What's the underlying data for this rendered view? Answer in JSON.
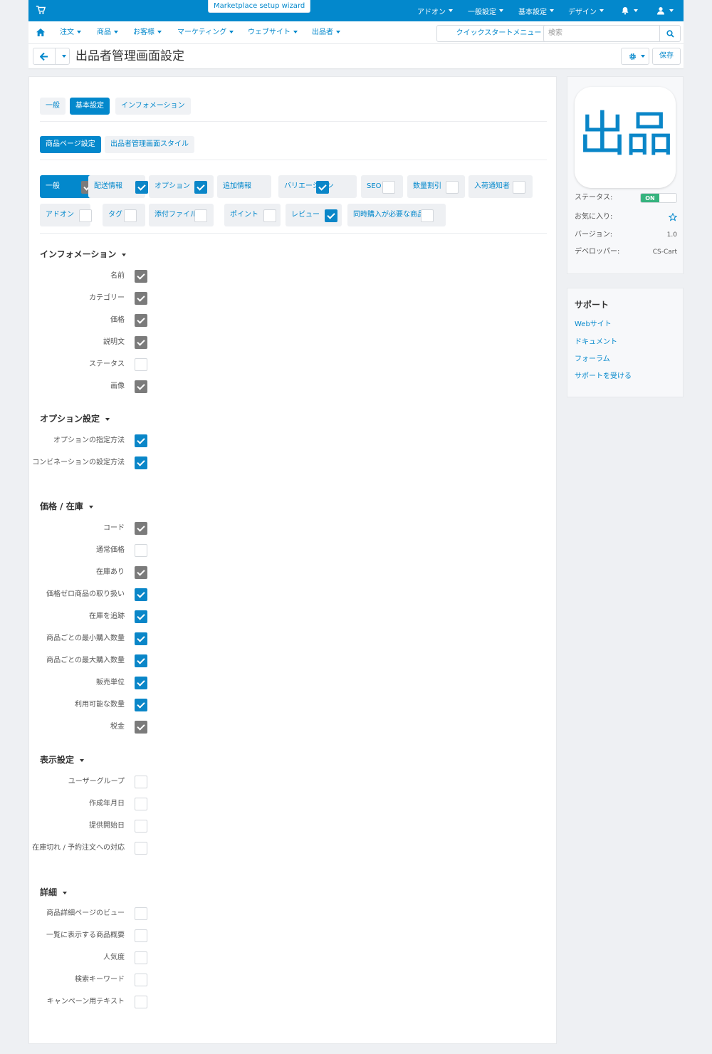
{
  "topbar": {
    "wizard_label": "Marketplace setup wizard",
    "menu": [
      "アドオン",
      "一般設定",
      "基本設定",
      "デザイン"
    ]
  },
  "navbar": {
    "items": [
      "注文",
      "商品",
      "お客様",
      "マーケティング",
      "ウェブサイト",
      "出品者"
    ],
    "quickstart_label": "クイックスタートメニュー",
    "search_placeholder": "検索"
  },
  "header": {
    "title": "出品者管理画面設定",
    "save_label": "保存"
  },
  "tabs": [
    "一般",
    "基本設定",
    "インフォメーション"
  ],
  "active_tab": "基本設定",
  "subtabs": [
    "商品ページ設定",
    "出品者管理画面スタイル"
  ],
  "active_subtab": "商品ページ設定",
  "chips": [
    {
      "label": "一般",
      "state": "grey",
      "active": true
    },
    {
      "label": "配送情報",
      "state": "on"
    },
    {
      "label": "オプション",
      "state": "on"
    },
    {
      "label": "追加情報",
      "state": "on"
    },
    {
      "label": "バリエーション",
      "state": "on"
    },
    {
      "label": "SEO",
      "state": "off"
    },
    {
      "label": "数量割引",
      "state": "off"
    },
    {
      "label": "入荷通知者",
      "state": "off"
    },
    {
      "label": "アドオン",
      "state": "off"
    },
    {
      "label": "タグ",
      "state": "off"
    },
    {
      "label": "添付ファイル",
      "state": "off"
    },
    {
      "label": "ポイント",
      "state": "off"
    },
    {
      "label": "レビュー",
      "state": "on"
    },
    {
      "label": "同時購入が必要な商品",
      "state": "off"
    }
  ],
  "sections": [
    {
      "title": "インフォメーション",
      "fields": [
        {
          "label": "名前",
          "state": "grey"
        },
        {
          "label": "カテゴリー",
          "state": "grey"
        },
        {
          "label": "価格",
          "state": "grey"
        },
        {
          "label": "説明文",
          "state": "grey"
        },
        {
          "label": "ステータス",
          "state": "off"
        },
        {
          "label": "画像",
          "state": "grey"
        }
      ]
    },
    {
      "title": "オプション設定",
      "fields": [
        {
          "label": "オプションの指定方法",
          "state": "on"
        },
        {
          "label": "コンビネーションの設定方法",
          "state": "on"
        }
      ]
    },
    {
      "title": "価格 / 在庫",
      "fields": [
        {
          "label": "コード",
          "state": "grey"
        },
        {
          "label": "通常価格",
          "state": "off"
        },
        {
          "label": "在庫あり",
          "state": "grey"
        },
        {
          "label": "価格ゼロ商品の取り扱い",
          "state": "on"
        },
        {
          "label": "在庫を追跡",
          "state": "on"
        },
        {
          "label": "商品ごとの最小購入数量",
          "state": "on"
        },
        {
          "label": "商品ごとの最大購入数量",
          "state": "on"
        },
        {
          "label": "販売単位",
          "state": "on"
        },
        {
          "label": "利用可能な数量",
          "state": "on"
        },
        {
          "label": "税金",
          "state": "grey"
        }
      ]
    },
    {
      "title": "表示設定",
      "fields": [
        {
          "label": "ユーザーグループ",
          "state": "off"
        },
        {
          "label": "作成年月日",
          "state": "off"
        },
        {
          "label": "提供開始日",
          "state": "off"
        },
        {
          "label": "在庫切れ / 予約注文への対応",
          "state": "off"
        }
      ]
    },
    {
      "title": "詳細",
      "fields": [
        {
          "label": "商品詳細ページのビュー",
          "state": "off"
        },
        {
          "label": "一覧に表示する商品概要",
          "state": "off"
        },
        {
          "label": "人気度",
          "state": "off"
        },
        {
          "label": "検索キーワード",
          "state": "off"
        },
        {
          "label": "キャンペーン用テキスト",
          "state": "off"
        }
      ]
    }
  ],
  "addon_info": {
    "icon_text": "出品",
    "status_label": "ステータス:",
    "status_value": "ON",
    "favorite_label": "お気に入り:",
    "version_label": "バージョン:",
    "version_value": "1.0",
    "developer_label": "デベロッパー:",
    "developer_value": "CS-Cart"
  },
  "support": {
    "title": "サポート",
    "links": [
      "Webサイト",
      "ドキュメント",
      "フォーラム",
      "サポートを受ける"
    ]
  },
  "colors": {
    "accent": "#0388cc",
    "checked": "#0a86c8",
    "disabled_checked": "#7b7b7b",
    "on_toggle": "#36b37e"
  }
}
